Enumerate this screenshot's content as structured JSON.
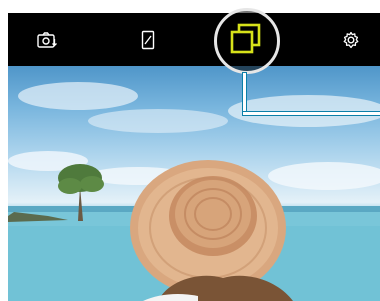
{
  "toolbar": {
    "switch_camera_icon": "camera-switch-icon",
    "aspect_icon": "aspect-ratio-icon",
    "multi_window_icon": "multi-window-icon",
    "settings_icon": "gear-icon",
    "active_color": "#d7e21a",
    "icon_color": "#ffffff"
  },
  "highlight": {
    "ring_color": "#e6e6e6",
    "callout_color": "#ffffff"
  },
  "preview": {
    "subject": "photo-preview"
  }
}
